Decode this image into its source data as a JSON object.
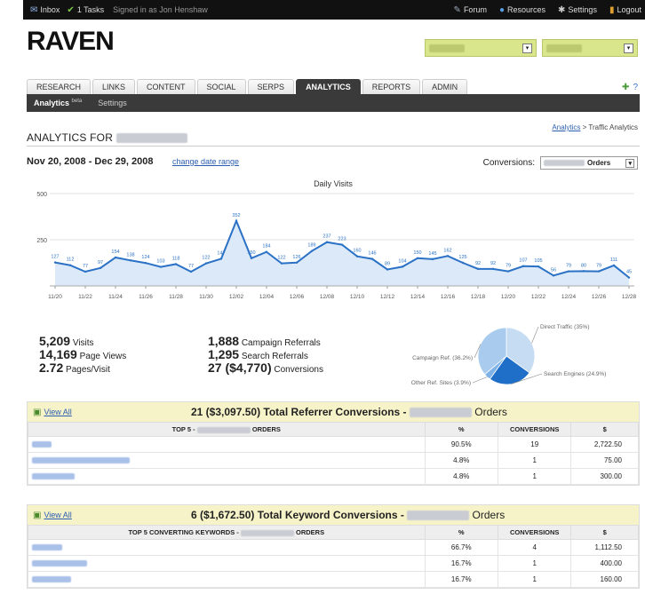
{
  "topbar": {
    "inbox": "Inbox",
    "tasks": "1 Tasks",
    "signed_in": "Signed in as Jon Henshaw",
    "forum": "Forum",
    "resources": "Resources",
    "settings": "Settings",
    "logout": "Logout"
  },
  "logo": "RAVEN",
  "tabs": [
    "RESEARCH",
    "LINKS",
    "CONTENT",
    "SOCIAL",
    "SERPS",
    "ANALYTICS",
    "REPORTS",
    "ADMIN"
  ],
  "active_tab": "ANALYTICS",
  "subnav": {
    "analytics": "Analytics",
    "beta": "beta",
    "settings": "Settings"
  },
  "breadcrumb": {
    "root": "Analytics",
    "sep": " > ",
    "current": "Traffic Analytics"
  },
  "page_title": "ANALYTICS FOR",
  "date_range": "Nov 20, 2008 - Dec 29, 2008",
  "change_date_range": "change date range",
  "conversions": {
    "label": "Conversions:",
    "selected": "Orders"
  },
  "chart_data": {
    "type": "area",
    "title": "Daily Visits",
    "ylim": [
      0,
      500
    ],
    "yticks": [
      0,
      250,
      500
    ],
    "ytick_labels": [
      "",
      "250",
      "500"
    ],
    "xtick_labels": [
      "11/20",
      "11/22",
      "11/24",
      "11/26",
      "11/28",
      "11/30",
      "12/02",
      "12/04",
      "12/06",
      "12/08",
      "12/10",
      "12/12",
      "12/14",
      "12/16",
      "12/18",
      "12/20",
      "12/22",
      "12/24",
      "12/26",
      "12/28"
    ],
    "values": [
      127,
      112,
      77,
      97,
      154,
      138,
      124,
      103,
      118,
      77,
      122,
      147,
      352,
      150,
      184,
      122,
      126,
      189,
      237,
      223,
      160,
      146,
      89,
      104,
      150,
      145,
      162,
      125,
      92,
      92,
      79,
      107,
      105,
      56,
      79,
      80,
      79,
      111,
      45
    ],
    "grid": true
  },
  "stats": {
    "visits": {
      "value": "5,209",
      "label": "Visits"
    },
    "page_views": {
      "value": "14,169",
      "label": "Page Views"
    },
    "pages_per_visit": {
      "value": "2.72",
      "label": "Pages/Visit"
    },
    "campaign_referrals": {
      "value": "1,888",
      "label": "Campaign Referrals"
    },
    "search_referrals": {
      "value": "1,295",
      "label": "Search Referrals"
    },
    "conversions": {
      "value": "27 ($4,770)",
      "label": "Conversions"
    }
  },
  "pie_data": {
    "type": "pie",
    "slices": [
      {
        "label": "Direct Traffic (35%)",
        "value": 35,
        "color": "#c6dcf2"
      },
      {
        "label": "Search Engines (24.9%)",
        "value": 24.9,
        "color": "#1f6fc9"
      },
      {
        "label": "Other Ref. Sites (3.9%)",
        "value": 3.9,
        "color": "#7fb2e6"
      },
      {
        "label": "Campaign Ref. (36.2%)",
        "value": 36.2,
        "color": "#a9cbee"
      }
    ]
  },
  "referrer_table": {
    "view_all": "View All",
    "title_bold": "21 ($3,097.50) Total Referrer Conversions -",
    "title_end": "Orders",
    "headers": [
      "TOP 5 -",
      "ORDERS",
      "%",
      "CONVERSIONS",
      "$"
    ],
    "rows": [
      {
        "pct": "90.5%",
        "conv": "19",
        "amount": "2,722.50"
      },
      {
        "pct": "4.8%",
        "conv": "1",
        "amount": "75.00"
      },
      {
        "pct": "4.8%",
        "conv": "1",
        "amount": "300.00"
      }
    ]
  },
  "keyword_table": {
    "view_all": "View All",
    "title_bold": "6 ($1,672.50) Total Keyword Conversions -",
    "title_end": "Orders",
    "headers": [
      "TOP 5 CONVERTING KEYWORDS -",
      "ORDERS",
      "%",
      "CONVERSIONS",
      "$"
    ],
    "rows": [
      {
        "pct": "66.7%",
        "conv": "4",
        "amount": "1,112.50"
      },
      {
        "pct": "16.7%",
        "conv": "1",
        "amount": "400.00"
      },
      {
        "pct": "16.7%",
        "conv": "1",
        "amount": "160.00"
      }
    ]
  }
}
